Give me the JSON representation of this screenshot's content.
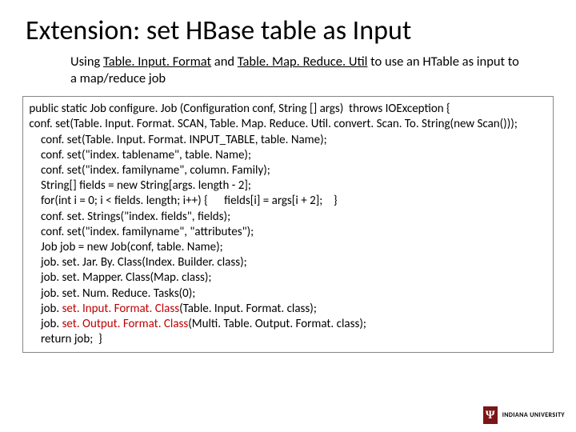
{
  "title": "Extension: set HBase table as Input",
  "subtitle": {
    "pre": "Using ",
    "u1": "Table. Input. Format",
    "mid1": " and ",
    "u2": "Table. Map. Reduce. Util",
    "mid2": " to use an HTable as input  to a map/reduce job"
  },
  "code": {
    "l1": " public static Job configure. Job (Configuration conf, String [] args)  throws IOException {",
    "l2": " conf. set(Table. Input. Format. SCAN, Table. Map. Reduce. Util. convert. Scan. To. String(new Scan()));",
    "l3": "conf. set(Table. Input. Format. INPUT_TABLE, table. Name);",
    "l4": "conf. set(\"index. tablename\", table. Name);",
    "l5": "conf. set(\"index. familyname\", column. Family);",
    "l6": "String[] fields = new String[args. length - 2];",
    "l7": "for(int i = 0; i < fields. length; i++) {      fields[i] = args[i + 2];    }",
    "l8": "conf. set. Strings(\"index. fields\", fields);",
    "l9": "conf. set(\"index. familyname\", \"attributes\");",
    "l10": "Job job = new Job(conf, table. Name);",
    "l11": "job. set. Jar. By. Class(Index. Builder. class);",
    "l12": "job. set. Mapper. Class(Map. class);",
    "l13": "job. set. Num. Reduce. Tasks(0);",
    "l14a": "job. ",
    "l14b": "set. Input. Format. Class",
    "l14c": "(Table. Input. Format. class);",
    "l15a": "job. ",
    "l15b": "set. Output. Format. Class",
    "l15c": "(Multi. Table. Output. Format. class);",
    "l16": "return job;  }"
  },
  "logo": {
    "mark": "Ψ",
    "text": "INDIANA UNIVERSITY"
  }
}
